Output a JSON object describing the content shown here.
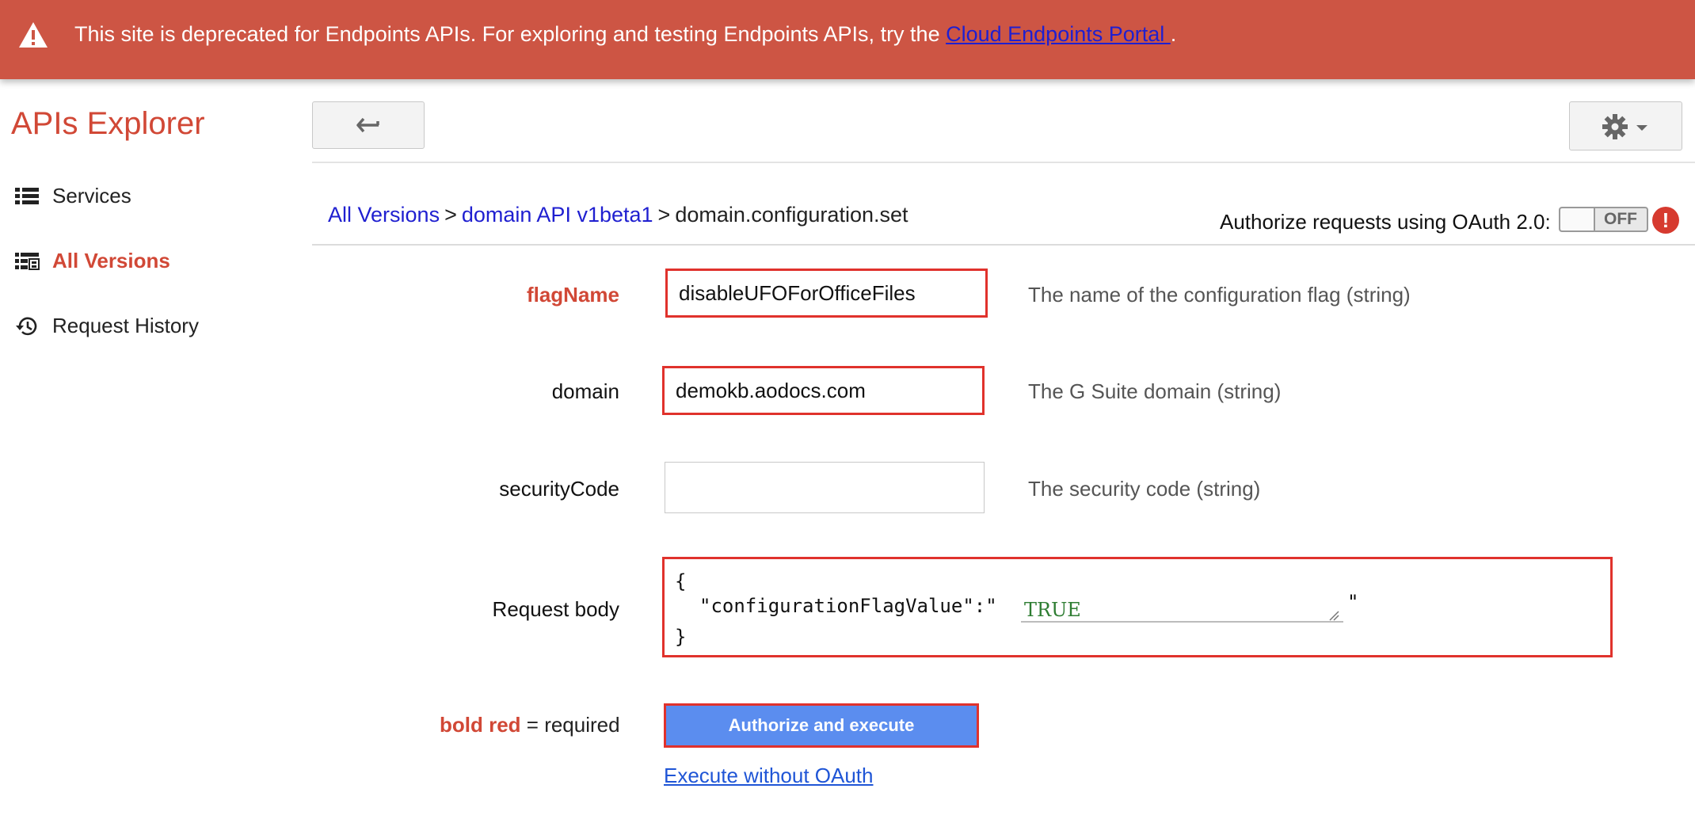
{
  "banner": {
    "message": "This site is deprecated for Endpoints APIs. For exploring and testing Endpoints APIs, try the ",
    "link_text": "Cloud Endpoints Portal ",
    "suffix": ".",
    "icon": "warning-triangle-icon",
    "color": "#cd5544"
  },
  "header": {
    "app_title": "APIs Explorer",
    "back_icon": "arrow-back-icon",
    "settings_icon": "gear-icon"
  },
  "sidebar": {
    "items": [
      {
        "label": "Services",
        "icon": "list-icon",
        "active": false
      },
      {
        "label": "All Versions",
        "icon": "versions-icon",
        "active": true
      },
      {
        "label": "Request History",
        "icon": "history-icon",
        "active": false
      }
    ]
  },
  "breadcrumb": {
    "items": [
      "All Versions",
      "domain API v1beta1",
      "domain.configuration.set"
    ],
    "separator": ">"
  },
  "oauth": {
    "label": "Authorize requests using OAuth 2.0:",
    "toggle_state": "OFF"
  },
  "form": {
    "fields": [
      {
        "label": "flagName",
        "value": "disableUFOForOfficeFiles",
        "description": "The name of the configuration flag (string)",
        "required": true
      },
      {
        "label": "domain",
        "value": "demokb.aodocs.com",
        "description": "The G Suite domain (string)",
        "required": false
      },
      {
        "label": "securityCode",
        "value": "",
        "description": "The security code (string)",
        "required": false
      }
    ],
    "request_body": {
      "label": "Request body",
      "open_brace": "{",
      "key": "\"configurationFlagValue\":\"",
      "value": "TRUE",
      "close_quote": "\"",
      "close_brace": "}"
    },
    "legend": {
      "bold_red": "bold red",
      "rest": " = required"
    },
    "execute_button": "Authorize and execute",
    "execute_link": "Execute without OAuth"
  },
  "colors": {
    "accent": "#d14836",
    "highlight": "#e0322c",
    "button": "#5b8def",
    "link": "#1f1fd0"
  }
}
